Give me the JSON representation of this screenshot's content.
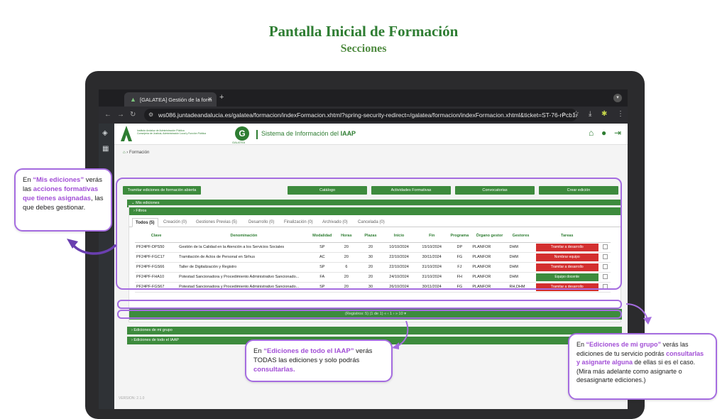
{
  "slide": {
    "title": "Pantalla Inicial de Formación",
    "subtitle": "Secciones"
  },
  "browser": {
    "tab_title": "[GALATEA] Gestión de la form",
    "new_tab": "+",
    "url": "ws086.juntadeandalucia.es/galatea/formacion/indexFormacion.xhtml?spring-security-redirect=/galatea/formacion/indexFormacion.xhtml&ticket=ST-76-rPcb1aTf5g..."
  },
  "app": {
    "institution": "Instituto Andaluz de Administración Pública\nConsejería de Justicia, Administración Local y Función Pública",
    "galatea_label": "GALATEA",
    "system_name_prefix": "Sistema de Información del ",
    "system_name_bold": "IAAP",
    "breadcrumb": "Formación",
    "version": "VERSION: 2.1.0",
    "top_buttons": [
      "Tramitar ediciones de formación abierta",
      "Catálogo",
      "Actividades Formativas",
      "Convocatorias",
      "Crear edición"
    ],
    "panels": {
      "mis_ediciones": "Mis ediciones",
      "filtros": "Filtros",
      "mi_grupo": "Ediciones de mi grupo",
      "todo_iaap": "Ediciones de todo el IAAP"
    },
    "tabs": [
      "Todos (5)",
      "Creación (0)",
      "Gestiones Previas (5)",
      "Desarrollo (0)",
      "Finalización (0)",
      "Archivado (0)",
      "Cancelada (0)"
    ],
    "columns": [
      "Clave",
      "Denominación",
      "Modalidad",
      "Horas",
      "Plazas",
      "Inicio",
      "Fin",
      "Programa",
      "Órgano gestor",
      "Gestores",
      "Tareas"
    ],
    "rows": [
      {
        "clave": "PF24PF-DPS50",
        "denominacion": "Gestión de la Calidad en la Atención a los Servicios Sociales",
        "modalidad": "SP",
        "horas": "20",
        "plazas": "20",
        "inicio": "10/10/2024",
        "fin": "15/10/2024",
        "programa": "DP",
        "organo": "PLANFOR",
        "gestores": "DHM",
        "tarea": "Tramitar a desarrollo",
        "tarea_color": "#d32f2f"
      },
      {
        "clave": "PF24PF-FGC17",
        "denominacion": "Tramitación de Actos de Personal en Sirhus",
        "modalidad": "AC",
        "horas": "20",
        "plazas": "30",
        "inicio": "22/10/2024",
        "fin": "30/11/2024",
        "programa": "FG",
        "organo": "PLANFOR",
        "gestores": "DHM",
        "tarea": "Nombrar equipo",
        "tarea_color": "#d32f2f"
      },
      {
        "clave": "PF24PF-FGS66",
        "denominacion": "Taller de Digitalización y Registro",
        "modalidad": "SP",
        "horas": "6",
        "plazas": "20",
        "inicio": "22/10/2024",
        "fin": "31/10/2024",
        "programa": "FJ",
        "organo": "PLANFOR",
        "gestores": "DHM",
        "tarea": "Tramitar a desarrollo",
        "tarea_color": "#d32f2f"
      },
      {
        "clave": "PF24PF-FHA10",
        "denominacion": "Potestad Sancionadora y Procedimiento Administrativo Sancionado...",
        "modalidad": "FA",
        "horas": "20",
        "plazas": "20",
        "inicio": "24/10/2024",
        "fin": "31/10/2024",
        "programa": "FH",
        "organo": "PLANFOR",
        "gestores": "DHM",
        "tarea": "Equipo docente",
        "tarea_color": "#3d8b3d"
      },
      {
        "clave": "PF24PF-FGS67",
        "denominacion": "Potestad Sancionadora y Procedimiento Administrativo Sancionado...",
        "modalidad": "SP",
        "horas": "20",
        "plazas": "30",
        "inicio": "26/10/2024",
        "fin": "30/11/2024",
        "programa": "FG",
        "organo": "PLANFOR",
        "gestores": "RH,DHM",
        "tarea": "Tramitar a desarrollo",
        "tarea_color": "#d32f2f"
      }
    ],
    "pager": "(Registros: 5)   (1 de 1)   «  ‹   1   ›  »   10 ▾"
  },
  "callouts": {
    "mis": {
      "p1": "En ",
      "h1": "“Mis ediciones”",
      "p2": " verás las ",
      "h2": "acciones formativas que tienes asignadas",
      "p3": ", las que debes gestionar."
    },
    "iaap": {
      "p1": "En ",
      "h1": "“Ediciones de  todo el IAAP”",
      "p2": " verás TODAS las ediciones y solo podrás ",
      "h2": "consultarlas."
    },
    "grupo": {
      "p1": "En ",
      "h1": "“Ediciones de mi grupo”",
      "p2": " verás las ediciones de tu servicio podrás ",
      "h2": "consultarlas y asignarte alguna",
      "p3": " de ellas si es el caso. (Mira más adelante como asignarte o desasignarte ediciones.)"
    }
  },
  "colors": {
    "primary_green": "#3d8b3d",
    "title_green": "#2e7d32",
    "highlight_purple": "#a56ce0",
    "danger_red": "#d32f2f"
  }
}
